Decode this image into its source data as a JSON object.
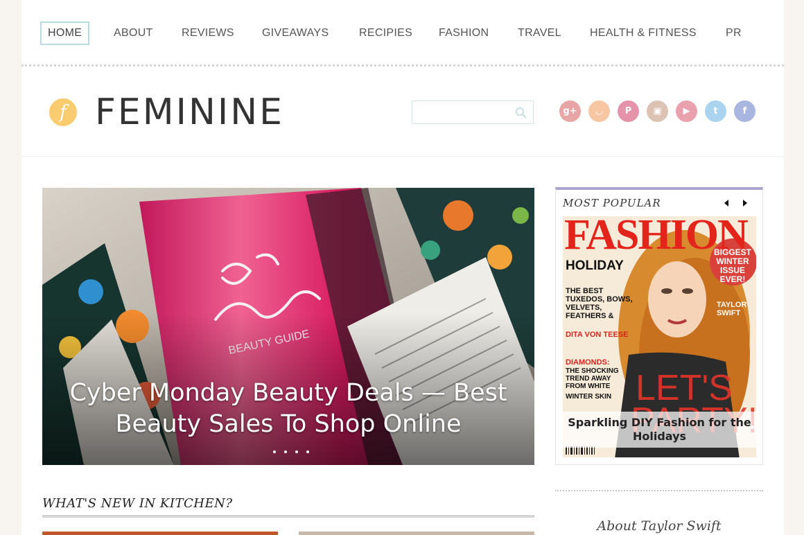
{
  "nav": {
    "items": [
      {
        "label": "HOME"
      },
      {
        "label": "ABOUT"
      },
      {
        "label": "REVIEWS"
      },
      {
        "label": "GIVEAWAYS"
      },
      {
        "label": "RECIPIES"
      },
      {
        "label": "FASHION"
      },
      {
        "label": "TRAVEL"
      },
      {
        "label": "HEALTH & FITNESS"
      },
      {
        "label": "PR"
      }
    ]
  },
  "header": {
    "logo_letter": "f",
    "site_title": "FEMININE",
    "search_placeholder": "",
    "social": [
      {
        "name": "google-plus",
        "glyph": "g+",
        "color": "#e8a5a5"
      },
      {
        "name": "rss",
        "glyph": "◡",
        "color": "#f7c6a3"
      },
      {
        "name": "pinterest",
        "glyph": "P",
        "color": "#e493ab"
      },
      {
        "name": "instagram",
        "glyph": "▣",
        "color": "#dcc3b4"
      },
      {
        "name": "youtube",
        "glyph": "▶",
        "color": "#e9a2ad"
      },
      {
        "name": "twitter",
        "glyph": "t",
        "color": "#a9d3ef"
      },
      {
        "name": "facebook",
        "glyph": "f",
        "color": "#a9b7e0"
      }
    ]
  },
  "slider": {
    "title": "Cyber Monday Beauty Deals — Best Beauty Sales To Shop Online",
    "slide_count": 4
  },
  "sidebar": {
    "popular_title": "MOST POPULAR",
    "popular_caption": "Sparkling DIY Fashion for the Holidays",
    "about_title": "About Taylor Swift"
  },
  "kitchen": {
    "title": "WHAT'S NEW IN KITCHEN?"
  },
  "colors": {
    "nav_active_border": "#b9dbe0",
    "popular_accent": "#a9a3ce",
    "logo_mark": "#f9cc6f"
  }
}
